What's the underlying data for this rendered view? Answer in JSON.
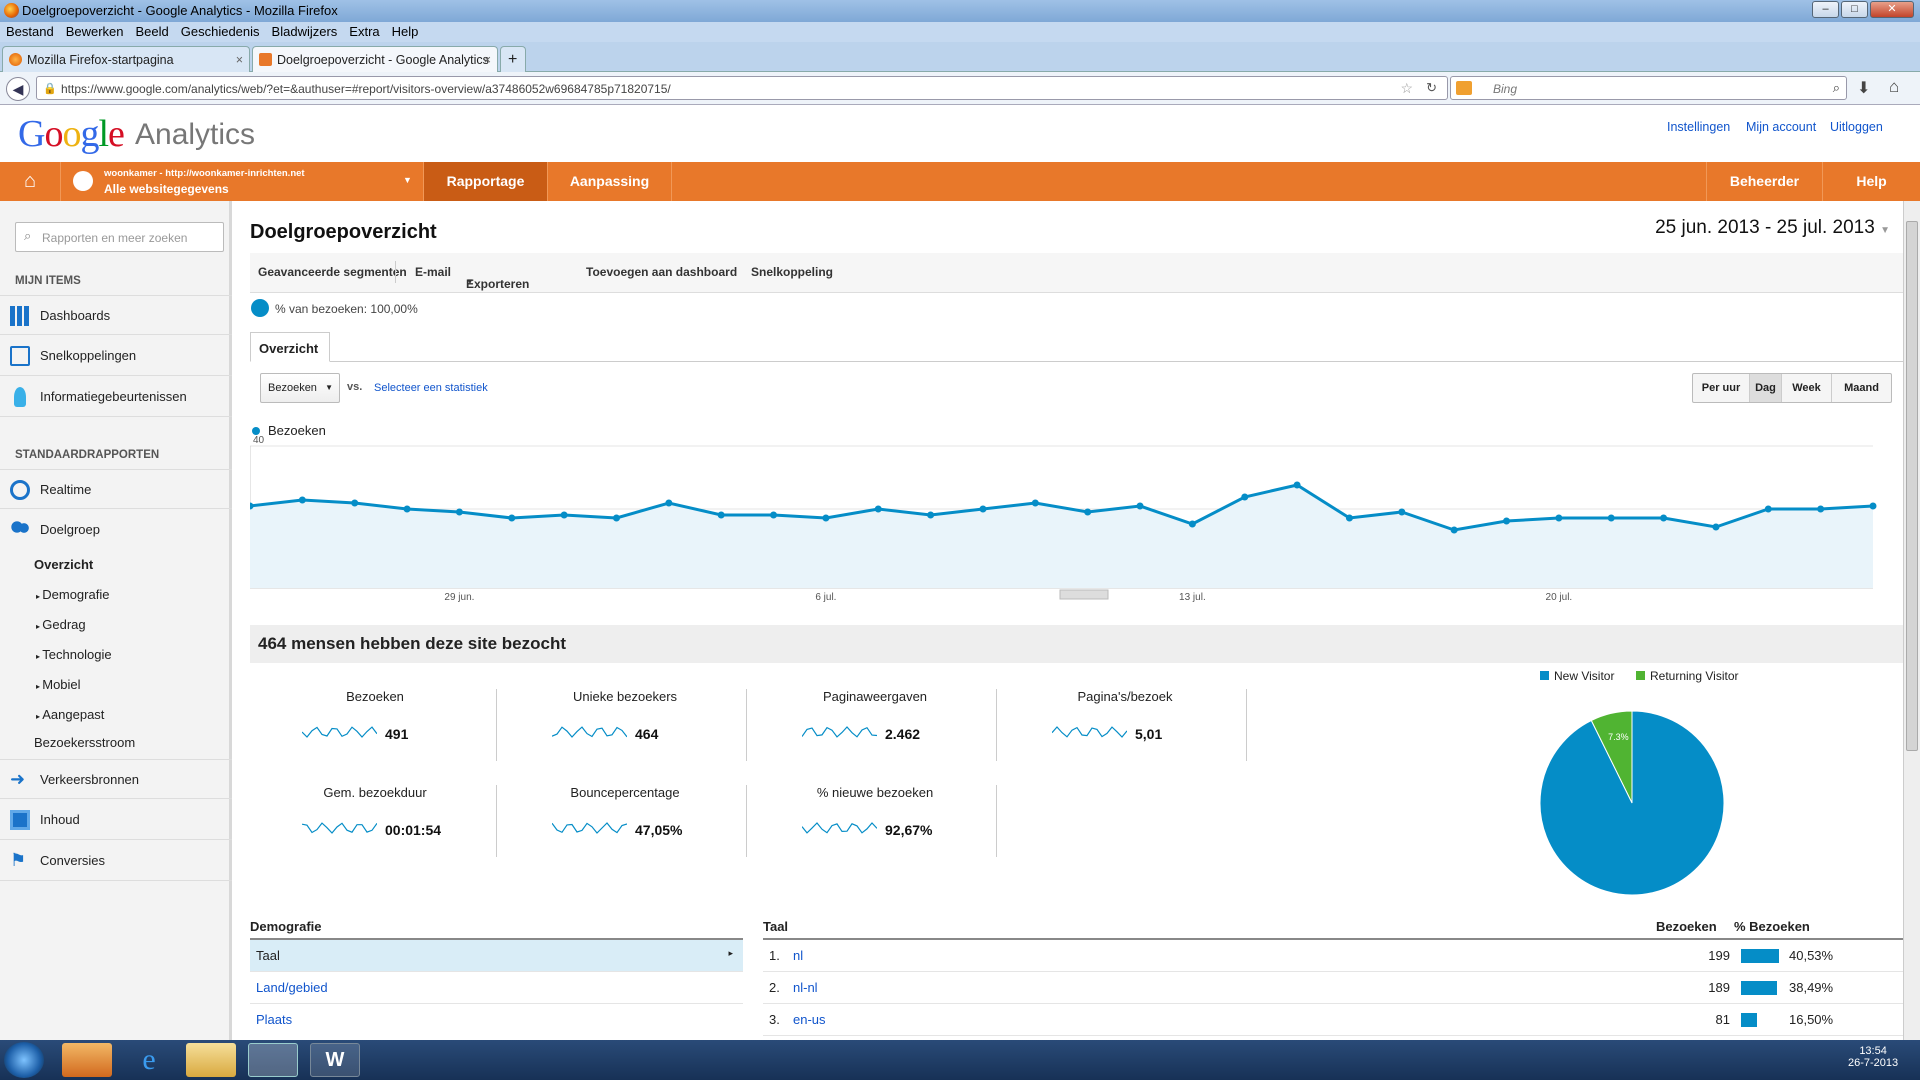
{
  "window": {
    "title": "Doelgroepoverzicht - Google Analytics - Mozilla Firefox"
  },
  "menubar": [
    "Bestand",
    "Bewerken",
    "Beeld",
    "Geschiedenis",
    "Bladwijzers",
    "Extra",
    "Help"
  ],
  "tabs": [
    {
      "label": "Mozilla Firefox-startpagina",
      "close": "×"
    },
    {
      "label": "Doelgroepoverzicht - Google Analytics",
      "close": "×"
    }
  ],
  "newtab": "+",
  "url": "https://www.google.com/analytics/web/?et=&authuser=#report/visitors-overview/a37486052w69684785p71820715/",
  "search": {
    "placeholder": "Bing"
  },
  "ga": {
    "logo_google": [
      "G",
      "o",
      "o",
      "g",
      "l",
      "e"
    ],
    "logo_analytics": "Analytics",
    "links": [
      "Instellingen",
      "Mijn account",
      "Uitloggen"
    ],
    "account_line1": "woonkamer - http://woonkamer-inrichten.net",
    "account_line2": "Alle websitegegevens",
    "nav": [
      "Rapportage",
      "Aanpassing"
    ],
    "nav_right": [
      "Beheerder",
      "Help"
    ]
  },
  "sidebar": {
    "search_placeholder": "Rapporten en meer zoeken",
    "mijn_items": "MIJN ITEMS",
    "items_top": [
      "Dashboards",
      "Snelkoppelingen",
      "Informatiegebeurtenissen"
    ],
    "standaard": "STANDAARDRAPPORTEN",
    "realtime": "Realtime",
    "doelgroep": "Doelgroep",
    "sub": [
      "Overzicht",
      "Demografie",
      "Gedrag",
      "Technologie",
      "Mobiel",
      "Aangepast",
      "Bezoekersstroom"
    ],
    "items_bottom": [
      "Verkeersbronnen",
      "Inhoud",
      "Conversies"
    ]
  },
  "main": {
    "title": "Doelgroepoverzicht",
    "daterange": "25 jun. 2013 - 25 jul. 2013",
    "actions": [
      "Geavanceerde segmenten",
      "E-mail",
      "Exporteren",
      "Toevoegen aan dashboard",
      "Snelkoppeling"
    ],
    "segment": "% van bezoeken: 100,00%",
    "tab": "Overzicht",
    "metric_select": "Bezoeken",
    "vs": "vs.",
    "select_stat": "Selecteer een statistiek",
    "granularity": [
      "Per uur",
      "Dag",
      "Week",
      "Maand"
    ],
    "summary": "464 mensen hebben deze site bezocht",
    "metrics": [
      {
        "label": "Bezoeken",
        "value": "491"
      },
      {
        "label": "Unieke bezoekers",
        "value": "464"
      },
      {
        "label": "Paginaweergaven",
        "value": "2.462"
      },
      {
        "label": "Pagina's/bezoek",
        "value": "5,01"
      },
      {
        "label": "Gem. bezoekduur",
        "value": "00:01:54"
      },
      {
        "label": "Bouncepercentage",
        "value": "47,05%"
      },
      {
        "label": "% nieuwe bezoeken",
        "value": "92,67%"
      }
    ],
    "demografie": {
      "header": "Demografie",
      "rows": [
        "Taal",
        "Land/gebied",
        "Plaats"
      ]
    },
    "taal_table": {
      "headers": [
        "Taal",
        "Bezoeken",
        "% Bezoeken"
      ],
      "rows": [
        {
          "rank": "1.",
          "name": "nl",
          "visits": "199",
          "pct": "40,53%",
          "frac": 0.4053
        },
        {
          "rank": "2.",
          "name": "nl-nl",
          "visits": "189",
          "pct": "38,49%",
          "frac": 0.3849
        },
        {
          "rank": "3.",
          "name": "en-us",
          "visits": "81",
          "pct": "16,50%",
          "frac": 0.165
        }
      ]
    }
  },
  "chart_data": [
    {
      "type": "line",
      "series": [
        {
          "name": "Bezoeken",
          "values": [
            20,
            22,
            21,
            19,
            18,
            16,
            17,
            16,
            21,
            17,
            17,
            16,
            19,
            17,
            19,
            21,
            18,
            20,
            14,
            23,
            27,
            16,
            18,
            12,
            15,
            16,
            16,
            16,
            13,
            19,
            19,
            20
          ]
        }
      ],
      "x": [
        "25 jun.",
        "26 jun.",
        "27 jun.",
        "28 jun.",
        "29 jun.",
        "30 jun.",
        "1 jul.",
        "2 jul.",
        "3 jul.",
        "4 jul.",
        "5 jul.",
        "6 jul.",
        "7 jul.",
        "8 jul.",
        "9 jul.",
        "10 jul.",
        "11 jul.",
        "12 jul.",
        "13 jul.",
        "14 jul.",
        "15 jul.",
        "16 jul.",
        "17 jul.",
        "18 jul.",
        "19 jul.",
        "20 jul.",
        "21 jul.",
        "22 jul.",
        "23 jul.",
        "24 jul.",
        "25 jul.",
        "26 jul."
      ],
      "xticks": [
        "29 jun.",
        "6 jul.",
        "13 jul.",
        "20 jul."
      ],
      "yticks": [
        "40",
        "20"
      ],
      "ylim": [
        0,
        40
      ],
      "color": "#058dc7"
    },
    {
      "type": "pie",
      "categories": [
        "New Visitor",
        "Returning Visitor"
      ],
      "values": [
        92.7,
        7.3
      ],
      "labels": [
        "92.7%",
        "7.3%"
      ],
      "colors": [
        "#058dc7",
        "#50b432"
      ],
      "legend": "top"
    }
  ],
  "taskbar": {
    "time": "13:54",
    "date": "26-7-2013"
  }
}
